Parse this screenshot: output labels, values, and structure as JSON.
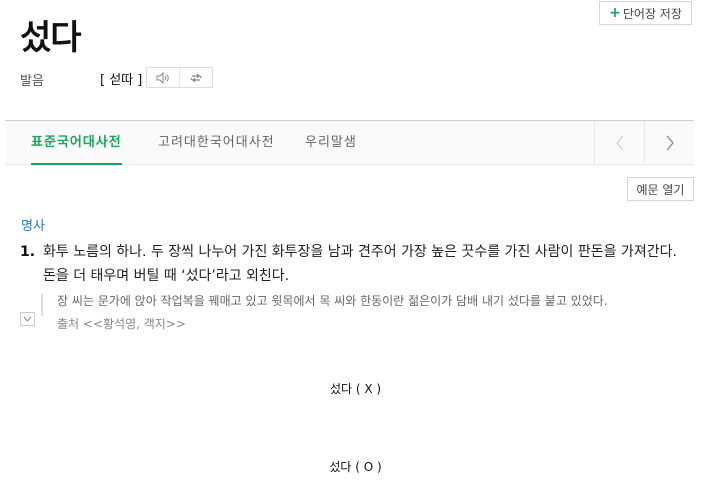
{
  "entry": {
    "title": "섰다"
  },
  "toolbar": {
    "save_plus": "+",
    "save_label": "단어장 저장"
  },
  "pronunciation": {
    "label": "발음",
    "value": "[ 섣따 ]",
    "speaker_icon": "speaker-icon",
    "replay_icon": "repeat-icon"
  },
  "tabs": [
    {
      "label": "표준국어대사전",
      "active": true
    },
    {
      "label": "고려대한국어대사전",
      "active": false
    },
    {
      "label": "우리말샘",
      "active": false
    }
  ],
  "example_toggle_label": "예문 열기",
  "definition": {
    "pos": "명사",
    "number": "1.",
    "text": "화투 노름의 하나. 두 장씩 나누어 가진 화투장을 남과 견주어 가장 높은 끗수를 가진 사람이 판돈을 가져간다. 돈을 더 태우며 버틸 때 ‘섰다’라고 외친다.",
    "example": "장 씨는 문가에 앉아 작업복을 꿰매고 있고 윗목에서 목 씨와 한동이란 젊은이가 담배 내기 섰다를 붙고 있었다.",
    "source": "출처 <<황석영, 객지>>"
  },
  "notes": {
    "wrong": "섰다 ( X )",
    "right": "섰다 ( O )"
  },
  "colors": {
    "accent": "#1aa35a",
    "pos": "#2b76b9"
  }
}
